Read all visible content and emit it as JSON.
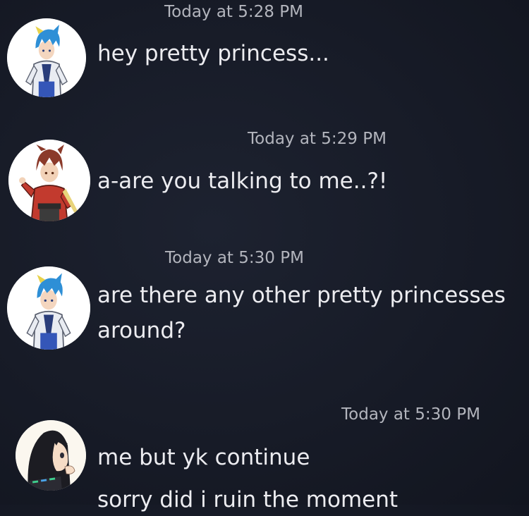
{
  "messages": [
    {
      "timestamp": "Today at 5:28 PM",
      "avatar_icon": "blue-hair-character-avatar",
      "lines": [
        "hey pretty princess..."
      ]
    },
    {
      "timestamp": "Today at 5:29 PM",
      "avatar_icon": "red-hair-character-avatar",
      "lines": [
        "a-are you talking to me..?!"
      ]
    },
    {
      "timestamp": "Today at 5:30 PM",
      "avatar_icon": "blue-hair-character-avatar",
      "lines": [
        "are there any other pretty princesses",
        "around?"
      ]
    },
    {
      "timestamp": "Today at 5:30 PM",
      "avatar_icon": "dark-hair-girl-avatar",
      "lines": [
        "me but yk continue",
        "sorry did i ruin the moment"
      ]
    }
  ],
  "colors": {
    "background": "#171b27",
    "message_text": "#ececf0",
    "timestamp_text": "#b3b5bd",
    "avatar_background": "#ffffff"
  }
}
